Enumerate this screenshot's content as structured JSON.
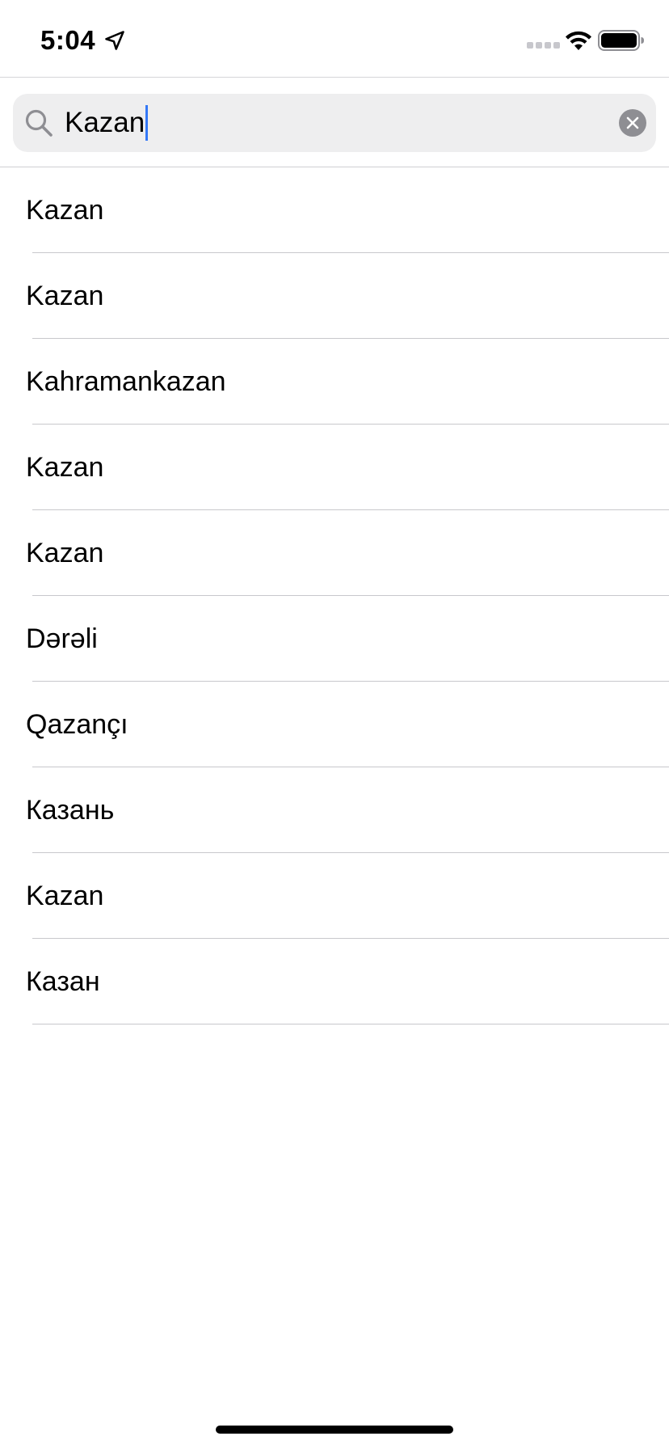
{
  "status_bar": {
    "time": "5:04",
    "icons": [
      "location-arrow-icon",
      "cellular-signal-icon",
      "wifi-icon",
      "battery-icon"
    ]
  },
  "search": {
    "value": "Kazan",
    "icon": "search-icon",
    "clear_icon": "clear-icon",
    "caret_color": "#3478f6",
    "field_background": "#eeeeef"
  },
  "results": [
    {
      "label": "Kazan"
    },
    {
      "label": "Kazan"
    },
    {
      "label": "Kahramankazan"
    },
    {
      "label": "Kazan"
    },
    {
      "label": "Kazan"
    },
    {
      "label": "Dərəli"
    },
    {
      "label": "Qazançı"
    },
    {
      "label": "Казань"
    },
    {
      "label": "Kazan"
    },
    {
      "label": "Казан"
    }
  ]
}
